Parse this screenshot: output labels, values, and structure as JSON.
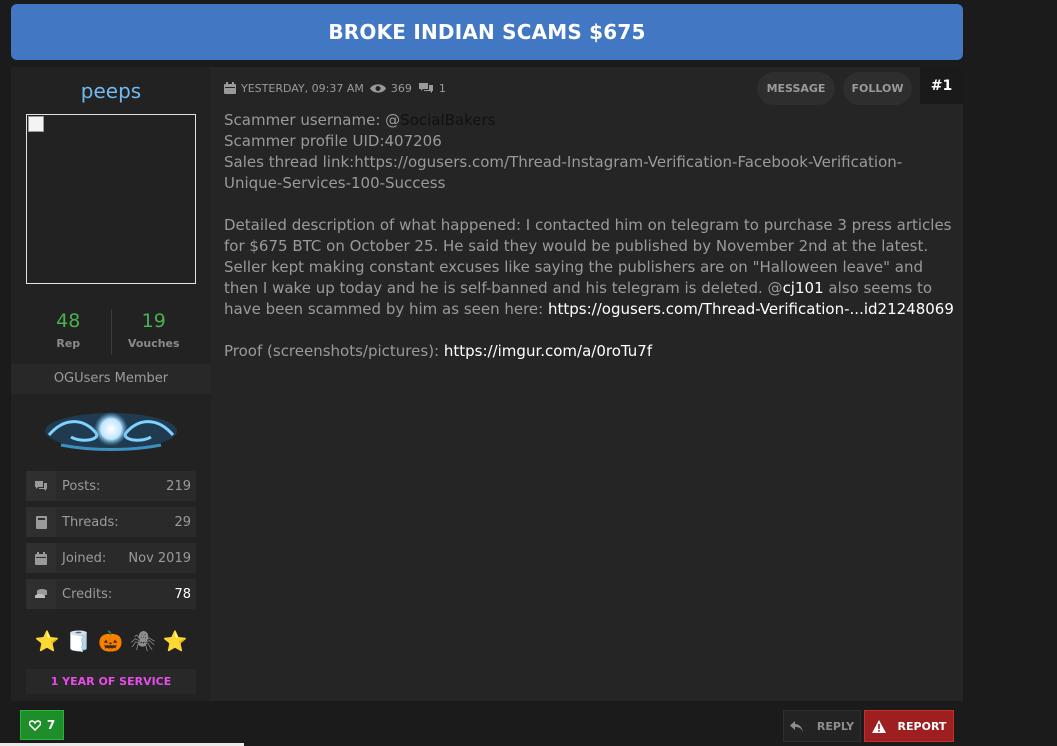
{
  "thread": {
    "title": "BROKE INDIAN SCAMS $675"
  },
  "user": {
    "name": "peeps",
    "rep_value": "48",
    "rep_label": "Rep",
    "vouches_value": "19",
    "vouches_label": "Vouches",
    "rank": "OGUsers Member",
    "info": [
      {
        "label": "Posts:",
        "value": "219",
        "icon": "comments-icon"
      },
      {
        "label": "Threads:",
        "value": "29",
        "icon": "book-icon"
      },
      {
        "label": "Joined:",
        "value": "Nov 2019",
        "icon": "calendar-icon"
      },
      {
        "label": "Credits:",
        "value": "78",
        "icon": "coins-icon"
      }
    ],
    "awards": [
      "⭐",
      "🧻",
      "🎃",
      "🕷",
      "⭐"
    ],
    "service_badge": "1 YEAR OF SERVICE"
  },
  "post": {
    "date": "YESTERDAY, 09:37 AM",
    "views": "369",
    "replies": "1",
    "message_label": "MESSAGE",
    "follow_label": "FOLLOW",
    "number": "#1",
    "line1_prefix": "Scammer username: @",
    "line1_handle": "SocialBakers",
    "line2": "Scammer profile UID:407206",
    "line3": "Sales thread link:https://ogusers.com/Thread-Instagram-Verification-Facebook-Verification-Unique-Services-100-Success",
    "desc_part1": "Detailed description of what happened: I contacted him on telegram to purchase 3 press articles for $675 BTC on October 25. He said they would be published by November 2nd at the latest. Seller kept making constant excuses like saying the publishers are on \"Halloween leave\" and then I wake up today and he is self-banned and his telegram is deleted. @",
    "desc_mention": "cj101",
    "desc_part2": " also seems to have been scammed by him as seen here: ",
    "desc_link": "https://ogusers.com/Thread-Verification-...id21248069",
    "proof_prefix": "Proof (screenshots/pictures): ",
    "proof_link": "https://imgur.com/a/0roTu7f"
  },
  "footer": {
    "likes": "7",
    "reply_label": "REPLY",
    "report_label": "REPORT"
  },
  "colors": {
    "title_bg": "#4277c3",
    "username": "#72b9ef",
    "rep_green": "#4caf50",
    "service_pink": "#e74ce8",
    "like_green": "#1e8e2a",
    "report_red": "#9e1f1f"
  }
}
